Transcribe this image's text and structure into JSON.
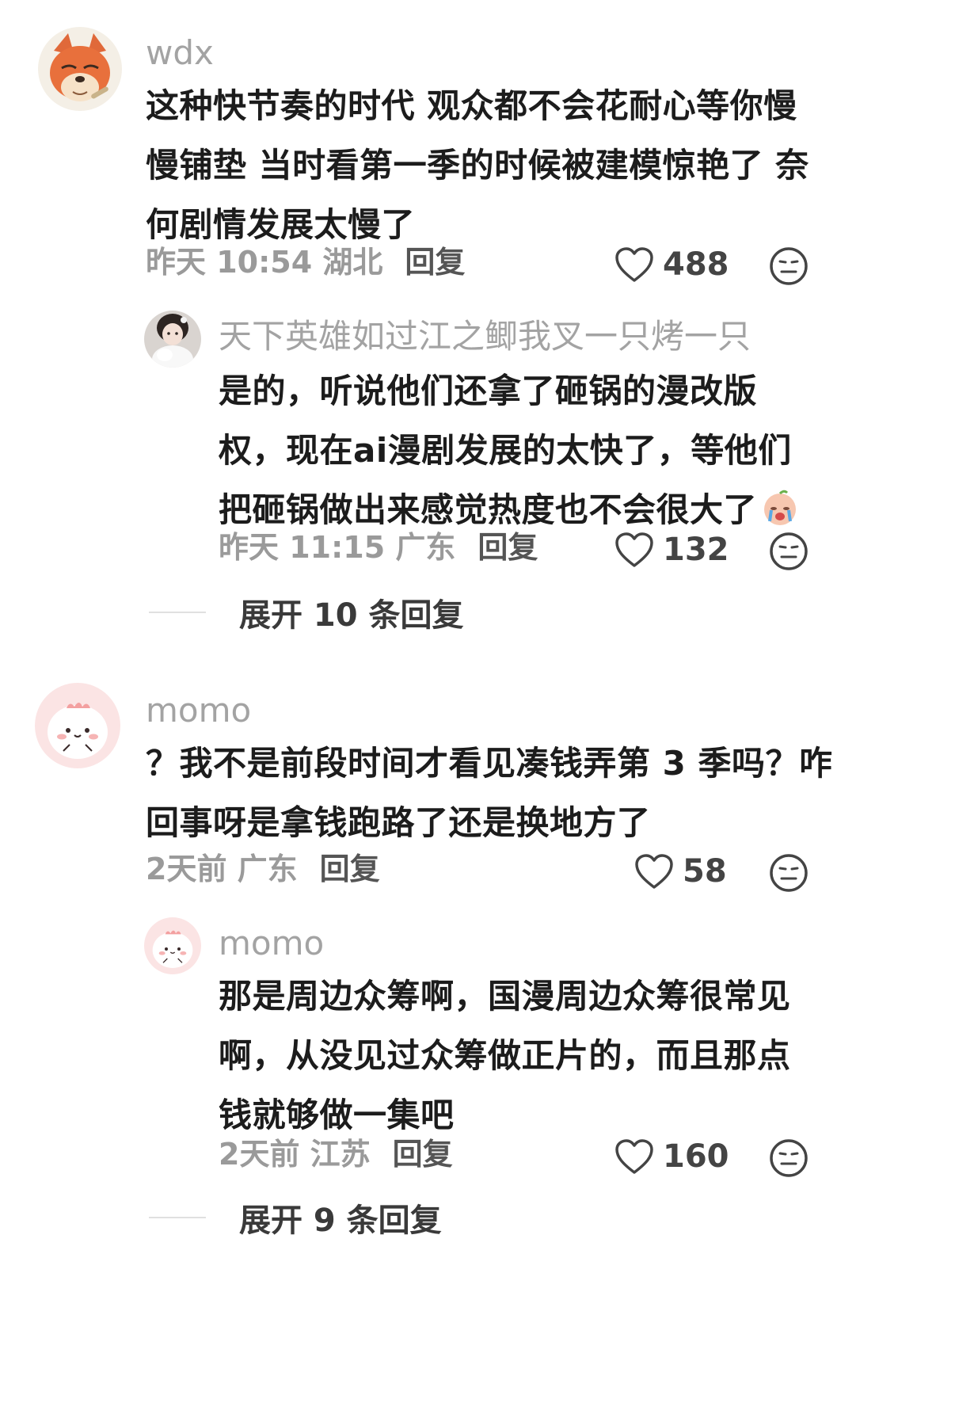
{
  "comments": [
    {
      "user": "wdx",
      "avatar": "fox-avatar",
      "lines": [
        "这种快节奏的时代 观众都不会花耐心等你慢",
        "慢铺垫 当时看第一季的时候被建模惊艳了 奈",
        "何剧情发展太慢了"
      ],
      "time": "昨天 10:54 湖北",
      "reply_label": "回复",
      "likes": "488",
      "replies": [
        {
          "user": "天下英雄如过江之鲫我叉一只烤一只",
          "avatar": "girl-with-cat-avatar",
          "lines": [
            "是的，听说他们还拿了砸锅的漫改版",
            "权，现在ai漫剧发展的太快了，等他们",
            "把砸锅做出来感觉热度也不会很大了"
          ],
          "emoji": "crying-face-emoji",
          "time": "昨天 11:15 广东",
          "reply_label": "回复",
          "likes": "132"
        }
      ],
      "expand_label": "展开 10 条回复"
    },
    {
      "user": "momo",
      "avatar": "pink-dino-avatar",
      "lines": [
        "？我不是前段时间才看见凑钱弄第 3 季吗？咋",
        "回事呀是拿钱跑路了还是换地方了"
      ],
      "time": "2天前 广东",
      "reply_label": "回复",
      "likes": "58",
      "replies": [
        {
          "user": "momo",
          "avatar": "pink-dino-avatar",
          "lines": [
            "那是周边众筹啊，国漫周边众筹很常见",
            "啊，从没见过众筹做正片的，而且那点",
            "钱就够做一集吧"
          ],
          "time": "2天前 江苏",
          "reply_label": "回复",
          "likes": "160"
        }
      ],
      "expand_label": "展开 9 条回复"
    }
  ]
}
